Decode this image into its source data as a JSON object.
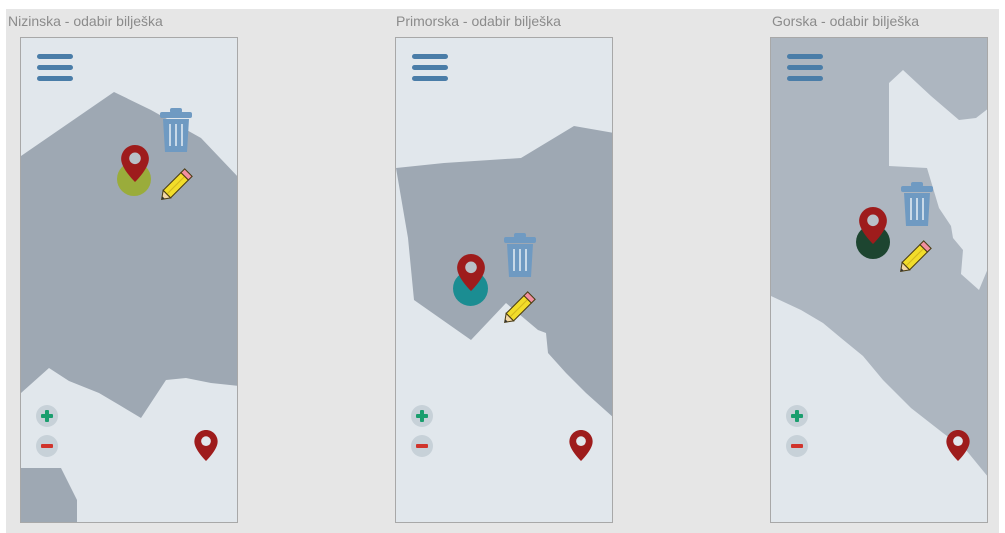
{
  "panels": [
    {
      "id": "nizinska",
      "title": "Nizinska - odabir bilješka",
      "note_color": "#9aac3b",
      "icons": {
        "menu": "hamburger-menu-icon",
        "delete": "trash-icon",
        "edit": "pencil-icon",
        "note_marker": "map-pin-icon",
        "zoom_in": "plus-icon",
        "zoom_out": "minus-icon",
        "location": "location-pin-icon"
      }
    },
    {
      "id": "primorska",
      "title": "Primorska - odabir bilješka",
      "note_color": "#1b8d92",
      "icons": {
        "menu": "hamburger-menu-icon",
        "delete": "trash-icon",
        "edit": "pencil-icon",
        "note_marker": "map-pin-icon",
        "zoom_in": "plus-icon",
        "zoom_out": "minus-icon",
        "location": "location-pin-icon"
      }
    },
    {
      "id": "gorska",
      "title": "Gorska - odabir bilješka",
      "note_color": "#1d4530",
      "icons": {
        "menu": "hamburger-menu-icon",
        "delete": "trash-icon",
        "edit": "pencil-icon",
        "note_marker": "map-pin-icon",
        "zoom_in": "plus-icon",
        "zoom_out": "minus-icon",
        "location": "location-pin-icon"
      }
    }
  ],
  "colors": {
    "background": "#e6e6e6",
    "map_land": "#9ea8b3",
    "map_sea": "#e1e7ec",
    "menu": "#4a7da8",
    "trash": "#6f9ac2",
    "pencil": "#f2dd2a",
    "marker": "#9e1c1c",
    "zoom_in": "#1a9e6e",
    "zoom_out": "#d0342c"
  }
}
